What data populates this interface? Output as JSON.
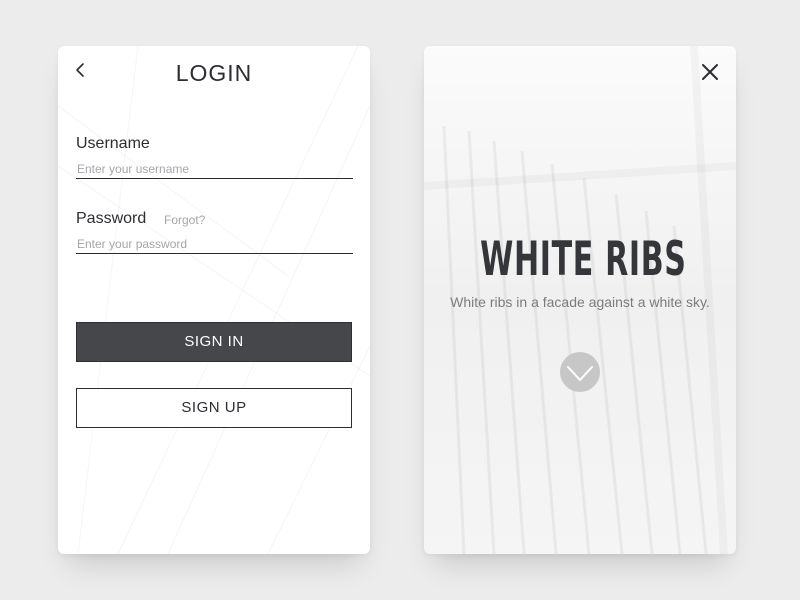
{
  "login_card": {
    "title": "LOGIN",
    "back_icon": "chevron-left-icon",
    "username": {
      "label": "Username",
      "placeholder": "Enter your username",
      "value": ""
    },
    "password": {
      "label": "Password",
      "forgot_label": "Forgot?",
      "placeholder": "Enter your password",
      "value": ""
    },
    "sign_in_label": "SIGN IN",
    "sign_up_label": "SIGN UP"
  },
  "hero_card": {
    "close_icon": "close-icon",
    "title": "WHITE RIBS",
    "subtitle": "White ribs in a facade against a white sky.",
    "scroll_icon": "chevron-down-icon"
  },
  "colors": {
    "page_background": "#ececec",
    "card_background": "#ffffff",
    "primary_text": "#2b2d31",
    "muted_text": "#a4a6aa",
    "sign_in_background": "#45474b",
    "chevron_circle": "#c7c7c7"
  }
}
